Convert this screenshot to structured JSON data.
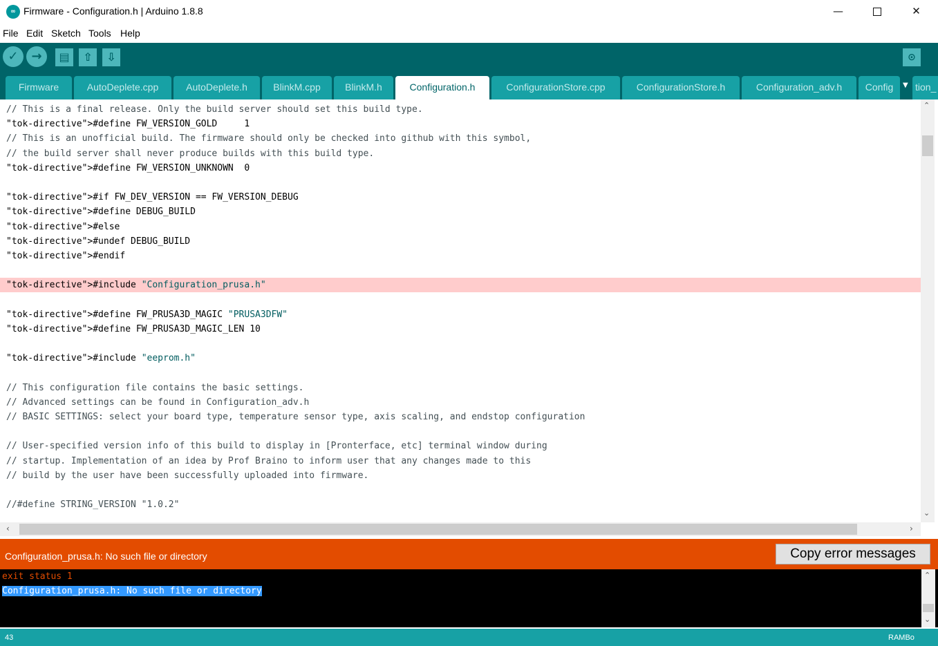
{
  "window": {
    "title": "Firmware - Configuration.h | Arduino 1.8.8",
    "icon": "arduino-logo-icon",
    "minimize_glyph": "—",
    "close_glyph": "✕"
  },
  "menu": [
    "File",
    "Edit",
    "Sketch",
    "Tools",
    "Help"
  ],
  "toolbar": {
    "verify_icon": "✓",
    "upload_icon": "→",
    "new_icon": "▤",
    "open_icon": "⇧",
    "save_icon": "⇩",
    "serial_monitor_icon": "⊙"
  },
  "tabs": [
    {
      "label": "Firmware",
      "active": false
    },
    {
      "label": "AutoDeplete.cpp",
      "active": false
    },
    {
      "label": "AutoDeplete.h",
      "active": false
    },
    {
      "label": "BlinkM.cpp",
      "active": false
    },
    {
      "label": "BlinkM.h",
      "active": false
    },
    {
      "label": "Configuration.h",
      "active": true
    },
    {
      "label": "ConfigurationStore.cpp",
      "active": false
    },
    {
      "label": "ConfigurationStore.h",
      "active": false
    },
    {
      "label": "Configuration_adv.h",
      "active": false
    },
    {
      "label": "Config",
      "active": false
    },
    {
      "label": "tion_",
      "active": false
    }
  ],
  "tab_menu_icon": "▼",
  "editor": {
    "lines": [
      "// This is a final release. Only the build server should set this build type.",
      "#define FW_VERSION_GOLD     1",
      "// This is an unofficial build. The firmware should only be checked into github with this symbol,",
      "// the build server shall never produce builds with this build type.",
      "#define FW_VERSION_UNKNOWN  0",
      "",
      "#if FW_DEV_VERSION == FW_VERSION_DEBUG",
      "#define DEBUG_BUILD",
      "#else",
      "#undef DEBUG_BUILD",
      "#endif",
      "",
      "#include \"Configuration_prusa.h\"",
      "",
      "#define FW_PRUSA3D_MAGIC \"PRUSA3DFW\"",
      "#define FW_PRUSA3D_MAGIC_LEN 10",
      "",
      "#include \"eeprom.h\"",
      "",
      "// This configuration file contains the basic settings.",
      "// Advanced settings can be found in Configuration_adv.h",
      "// BASIC SETTINGS: select your board type, temperature sensor type, axis scaling, and endstop configuration",
      "",
      "// User-specified version info of this build to display in [Pronterface, etc] terminal window during",
      "// startup. Implementation of an idea by Prof Braino to inform user that any changes made to this",
      "// build by the user have been successfully uploaded into firmware.",
      "",
      "//#define STRING_VERSION \"1.0.2\""
    ],
    "error_line_index": 12
  },
  "scrollbars": {
    "up": "⌃",
    "down": "⌄",
    "left": "‹",
    "right": "›"
  },
  "error_bar": {
    "message": "Configuration_prusa.h: No such file or directory",
    "copy_button": "Copy error messages",
    "color": "#e34c00"
  },
  "console": {
    "lines": [
      {
        "text": "exit status 1",
        "type": "exit"
      },
      {
        "text": "Configuration_prusa.h: No such file or directory",
        "type": "selected"
      }
    ]
  },
  "status": {
    "line_number": "43",
    "board": "RAMBo"
  },
  "colors": {
    "toolbar": "#006468",
    "tab_inactive": "#17a1a5",
    "status_bar": "#17a1a5",
    "error_highlight": "#ffcccc"
  }
}
